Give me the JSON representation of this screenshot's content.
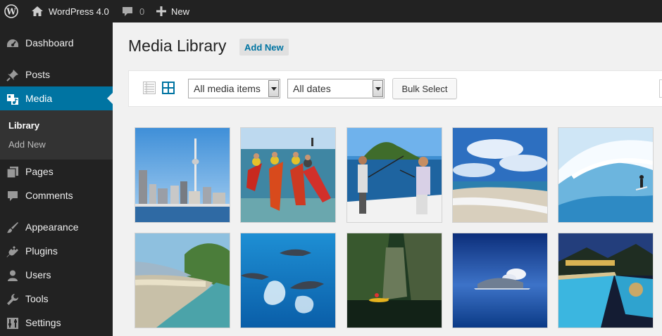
{
  "admin_bar": {
    "site_name": "WordPress 4.0",
    "comments_count": "0",
    "new_label": "New"
  },
  "sidebar": {
    "items": [
      {
        "label": "Dashboard",
        "icon": "dashboard-icon"
      },
      {
        "label": "Posts",
        "icon": "pushpin-icon"
      },
      {
        "label": "Media",
        "icon": "media-icon"
      },
      {
        "label": "Pages",
        "icon": "pages-icon"
      },
      {
        "label": "Comments",
        "icon": "comment-icon"
      },
      {
        "label": "Appearance",
        "icon": "paintbrush-icon"
      },
      {
        "label": "Plugins",
        "icon": "plugin-icon"
      },
      {
        "label": "Users",
        "icon": "user-icon"
      },
      {
        "label": "Tools",
        "icon": "wrench-icon"
      },
      {
        "label": "Settings",
        "icon": "settings-icon"
      }
    ],
    "submenu": [
      {
        "label": "Library"
      },
      {
        "label": "Add New"
      }
    ]
  },
  "main": {
    "title": "Media Library",
    "add_new_label": "Add New",
    "filter_type": {
      "selected": "All media items"
    },
    "filter_date": {
      "selected": "All dates"
    },
    "bulk_select_label": "Bulk Select"
  },
  "media_items": [
    {
      "subject": "city-skyline-tower"
    },
    {
      "subject": "kayakers"
    },
    {
      "subject": "fishing-boat-island"
    },
    {
      "subject": "beach-clouds"
    },
    {
      "subject": "surfer-wave"
    },
    {
      "subject": "bay-beach-aerial"
    },
    {
      "subject": "dolphins"
    },
    {
      "subject": "rainforest-canoe"
    },
    {
      "subject": "island-ocean"
    },
    {
      "subject": "resort-pool-night"
    }
  ],
  "colors": {
    "admin_bar_bg": "#222222",
    "menu_active": "#0074a2",
    "page_bg": "#f1f1f1",
    "link": "#0074a2"
  }
}
